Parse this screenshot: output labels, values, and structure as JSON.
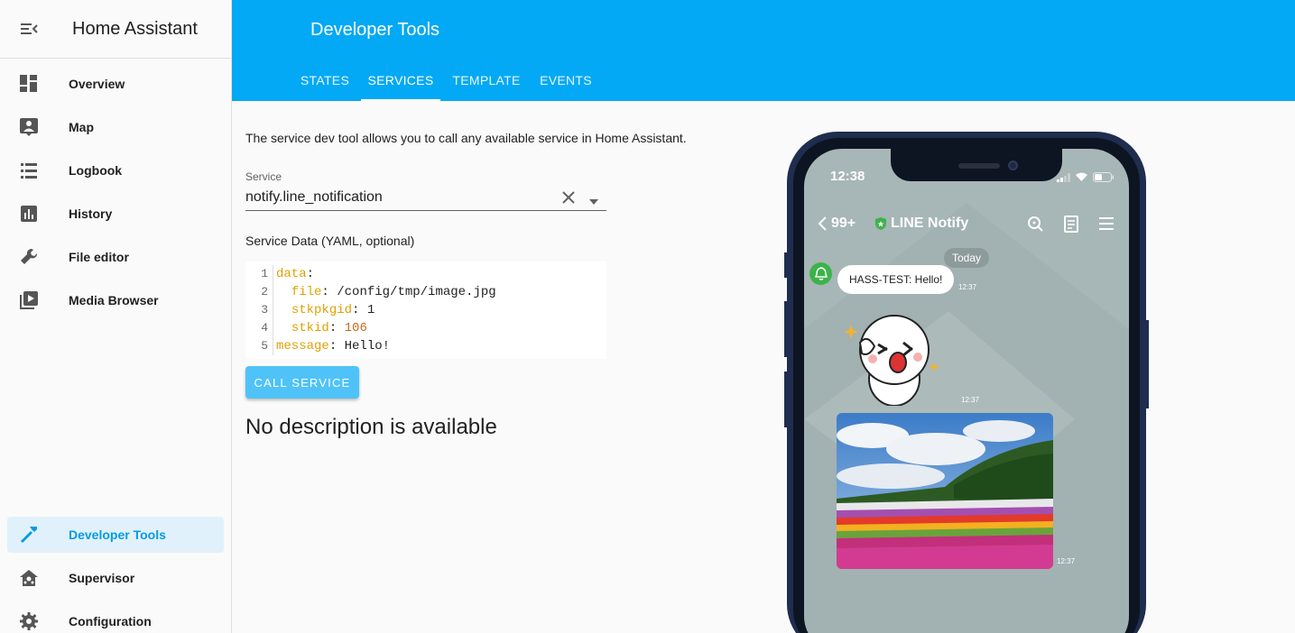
{
  "sidebar": {
    "title": "Home Assistant",
    "items": [
      {
        "label": "Overview",
        "icon": "overview-icon"
      },
      {
        "label": "Map",
        "icon": "map-icon"
      },
      {
        "label": "Logbook",
        "icon": "logbook-icon"
      },
      {
        "label": "History",
        "icon": "history-icon"
      },
      {
        "label": "File editor",
        "icon": "wrench-icon"
      },
      {
        "label": "Media Browser",
        "icon": "media-icon"
      },
      {
        "label": "Developer Tools",
        "icon": "hammer-icon",
        "active": true
      },
      {
        "label": "Supervisor",
        "icon": "supervisor-icon"
      },
      {
        "label": "Configuration",
        "icon": "gear-icon"
      }
    ]
  },
  "header": {
    "title": "Developer Tools",
    "tabs": [
      {
        "label": "STATES"
      },
      {
        "label": "SERVICES",
        "active": true
      },
      {
        "label": "TEMPLATE"
      },
      {
        "label": "EVENTS"
      }
    ]
  },
  "main": {
    "description": "The service dev tool allows you to call any available service in Home Assistant.",
    "service_label": "Service",
    "service_value": "notify.line_notification",
    "service_data_label": "Service Data (YAML, optional)",
    "code": {
      "line_numbers": [
        "1",
        "2",
        "3",
        "4",
        "5"
      ],
      "line1_key": "data",
      "line2_key": "file",
      "line2_value": "/config/tmp/image.jpg",
      "line3_key": "stkpkgid",
      "line3_value": "1",
      "line4_key": "stkid",
      "line4_value": "106",
      "line5_key": "message",
      "line5_value": "Hello!"
    },
    "call_button": "CALL SERVICE",
    "no_description": "No description is available"
  },
  "phone": {
    "time": "12:38",
    "unread_count": "99+",
    "chat_title": "LINE Notify",
    "date_chip": "Today",
    "message_text": "HASS-TEST: Hello!",
    "timestamps": [
      "12:37",
      "12:37",
      "12:37"
    ]
  },
  "colors": {
    "header": "#03a9f4",
    "accent": "#039be5",
    "active_bg": "#e1f1fb",
    "button": "#4fc3f7"
  }
}
